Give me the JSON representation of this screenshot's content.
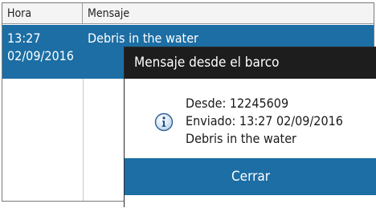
{
  "table": {
    "headers": {
      "time": "Hora",
      "message": "Mensaje"
    },
    "rows": [
      {
        "time_line1": "13:27",
        "time_line2": "02/09/2016",
        "message": "Debris in the water"
      }
    ]
  },
  "dialog": {
    "title": "Mensaje desde el barco",
    "icon": "info-icon",
    "from": "Desde: 12245609",
    "sent": "Enviado: 13:27 02/09/2016",
    "body": "Debris in the water",
    "close_label": "Cerrar"
  },
  "colors": {
    "selection": "#1c6ea4",
    "title_bar": "#1d1d1d",
    "button": "#1c6ea4"
  }
}
